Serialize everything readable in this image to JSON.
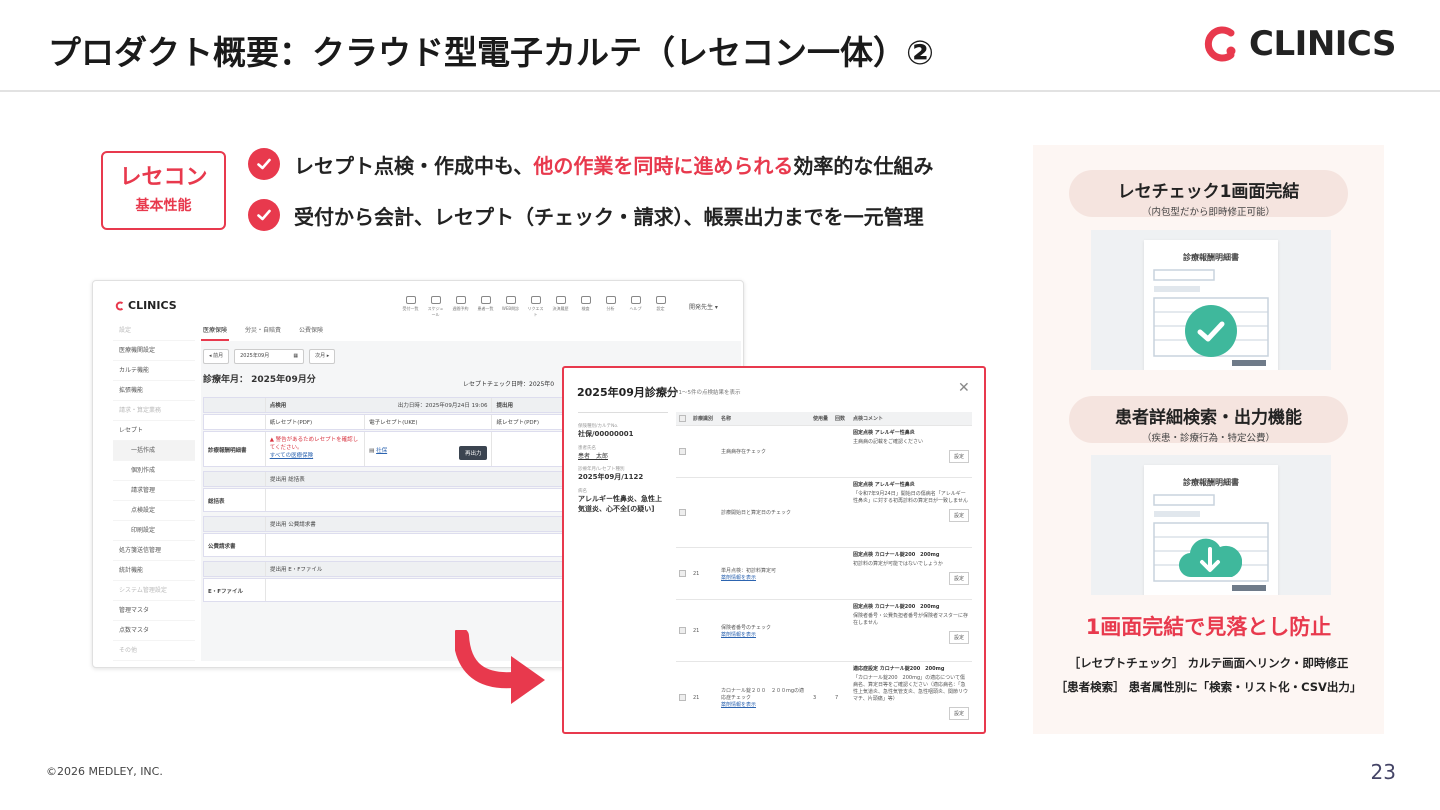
{
  "header": {
    "title": "プロダクト概要：クラウド型電子カルテ（レセコン一体）②",
    "logo_text": "CLINICS"
  },
  "badge": {
    "main": "レセコン",
    "sub": "基本性能"
  },
  "features": [
    {
      "before": "レセプト点検・作成中も、",
      "highlight": "他の作業を同時に進められる",
      "after": "効率的な仕組み"
    },
    {
      "before": "受付から会計、レセプト（チェック・請求）、帳票出力までを一元管理",
      "highlight": "",
      "after": ""
    }
  ],
  "app": {
    "logo": "CLINICS",
    "toolbar": [
      "受付一覧",
      "スケジュール",
      "週間予約",
      "患者一覧",
      "WEB問診",
      "リクエスト",
      "決済履歴",
      "検査",
      "分析",
      "ヘルプ",
      "設定"
    ],
    "user": "開発先生",
    "sidebar": [
      {
        "label": "設定",
        "type": "muted"
      },
      {
        "label": "医療機関設定",
        "type": "item"
      },
      {
        "label": "カルテ機能",
        "type": "item"
      },
      {
        "label": "拡張機能",
        "type": "item"
      },
      {
        "label": "請求・算定業務",
        "type": "muted"
      },
      {
        "label": "レセプト",
        "type": "item"
      },
      {
        "label": "一括作成",
        "type": "sub-active"
      },
      {
        "label": "個別作成",
        "type": "sub"
      },
      {
        "label": "請求管理",
        "type": "sub"
      },
      {
        "label": "点検設定",
        "type": "sub"
      },
      {
        "label": "印刷設定",
        "type": "sub"
      },
      {
        "label": "処方箋送信管理",
        "type": "item"
      },
      {
        "label": "統計機能",
        "type": "item"
      },
      {
        "label": "システム管理設定",
        "type": "muted"
      },
      {
        "label": "管理マスタ",
        "type": "item"
      },
      {
        "label": "点数マスタ",
        "type": "item"
      },
      {
        "label": "その他",
        "type": "muted"
      }
    ],
    "tabs": [
      "医療保険",
      "労災・自賠責",
      "公費保険"
    ],
    "prev_btn": "◂ 前月",
    "month_value": "2025年09月",
    "next_btn": "次月 ▸",
    "period": "診療年月： 2025年09月分",
    "check_date": "レセプトチェック日時：2025年0",
    "grid": {
      "head_left": "点検用",
      "head_date": "出力日時：2025年09月24日 19:06",
      "head_right": "提出用",
      "col_pdf": "紙レセプト(PDF)",
      "col_uke": "電子レセプト(UKE)",
      "col_pdf2": "紙レセプト(PDF)",
      "row1_label": "診療報酬明細書",
      "row1_warn": "▲ 警告があるためレセプトを確認してください。",
      "row1_link": "すべての医療保険",
      "row1_uke": "社保",
      "row1_btn": "再出力",
      "row2_head": "提出用 総括表",
      "row2_label": "総括表",
      "row3_head": "提出用 公費請求書",
      "row3_label": "公費請求書",
      "row4_head": "提出用 E・Fファイル",
      "row4_label": "E・Fファイル"
    }
  },
  "modal": {
    "title": "2025年09月診療分",
    "count": "5件中1〜5件の点検結果を表示",
    "info": [
      {
        "label": "保険種別/カルテNo.",
        "value": "社保/00000001"
      },
      {
        "label": "患者氏名",
        "value": "患者　太郎"
      },
      {
        "label": "診療年月/レセプト種別",
        "value": "2025年09月/1122"
      },
      {
        "label": "病名",
        "value": "アレルギー性鼻炎、急性上気道炎、心不全[の疑い]"
      }
    ],
    "headers": [
      "",
      "診療識別",
      "名称",
      "使用量",
      "回数",
      "点検コメント"
    ],
    "rows": [
      {
        "code": "",
        "name": "主病病存在チェック",
        "link": "",
        "qty": "",
        "cnt": "",
        "title": "固定点検 アレルギー性鼻炎",
        "comment": "主病病の記載をご確認ください"
      },
      {
        "code": "",
        "name": "診療開始日と算定日のチェック",
        "link": "",
        "qty": "",
        "cnt": "",
        "title": "固定点検 アレルギー性鼻炎",
        "comment": "「令和7年9月24日」開始日の傷病名「アレルギー性鼻炎」に対する初再診料の算定日が一致しません"
      },
      {
        "code": "21",
        "name": "単月点検：初診料算定可",
        "link": "薬剤情報を表示",
        "qty": "",
        "cnt": "",
        "title": "固定点検 カロナール錠200　200mg",
        "comment": "初診料の算定が可能ではないでしょうか"
      },
      {
        "code": "21",
        "name": "保険者番号のチェック",
        "link": "薬剤情報を表示",
        "qty": "",
        "cnt": "",
        "title": "固定点検 カロナール錠200　200mg",
        "comment": "保険者番号・公費負担者番号が保険者マスターに存在しません"
      },
      {
        "code": "21",
        "name": "カロナール錠２００　２００mgの適応症チェック",
        "link": "薬剤情報を表示",
        "qty": "3",
        "cnt": "7",
        "title": "適応症設定 カロナール錠200　200mg",
        "comment": "「カロナール錠200　200mg」の適応について傷病名、算定日等をご確認ください（適応病名：「急性上気道炎、急性気管支炎、急性咽頭炎、関節リウマチ、片頭痛」等）"
      }
    ],
    "set_label": "設定"
  },
  "panel": {
    "card1": {
      "title": "レセチェック1画面完結",
      "sub": "（内包型だから即時修正可能）",
      "doc_title": "診療報酬明細書"
    },
    "card2": {
      "title": "患者詳細検索・出力機能",
      "sub": "（疾患・診療行為・特定公費）",
      "doc_title": "診療報酬明細書"
    },
    "lead": "1画面完結で見落とし防止",
    "notes": [
      "［レセプトチェック］ カルテ画面へリンク・即時修正",
      "［患者検索］ 患者属性別に「検索・リスト化・CSV出力」"
    ]
  },
  "footer": {
    "copyright": "©2026 MEDLEY, INC.",
    "page": "23"
  },
  "colors": {
    "accent": "#e8394d",
    "teal": "#34b59a"
  }
}
